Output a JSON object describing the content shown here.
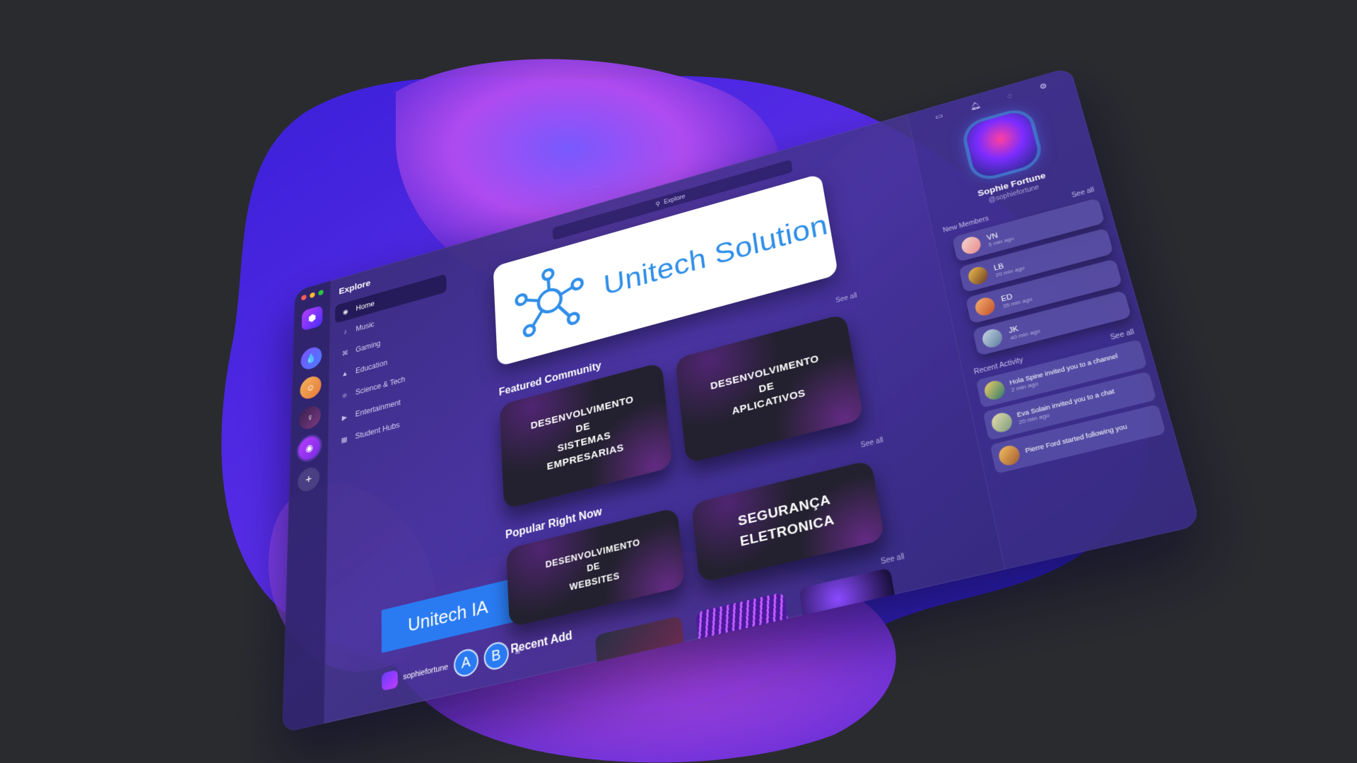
{
  "colors": {
    "background": "#2a2b2f",
    "accent_blue": "#2a7bf2",
    "hero_text": "#2f8ee8",
    "card_bg": "#23212f"
  },
  "sidebar": {
    "title": "Explore",
    "items": [
      {
        "label": "Home",
        "icon": "compass-icon",
        "active": true
      },
      {
        "label": "Music",
        "icon": "music-note-icon"
      },
      {
        "label": "Gaming",
        "icon": "gamepad-icon"
      },
      {
        "label": "Education",
        "icon": "graduation-cap-icon"
      },
      {
        "label": "Science & Tech",
        "icon": "atom-icon"
      },
      {
        "label": "Entertainment",
        "icon": "play-icon"
      },
      {
        "label": "Student Hubs",
        "icon": "building-icon"
      }
    ],
    "ia_button": "Unitech IA",
    "username": "sophiefortune",
    "btn_a": "A",
    "btn_b": "B"
  },
  "search": {
    "placeholder": "Explore"
  },
  "hero": {
    "title": "Unitech Solution"
  },
  "sections": {
    "featured": "Featured Community",
    "popular": "Popular Right Now",
    "recent": "Recent Add",
    "see_all": "See all"
  },
  "cards": {
    "c1": "DESENVOLVIMENTO\nDE\nSISTEMAS\nEMPRESARIAS",
    "c2": "DESENVOLVIMENTO\nDE\nAPLICATIVOS",
    "c3": "DESENVOLVIMENTO\nDE\nWEBSITES",
    "c4": "SEGURANÇA\nELETRONICA"
  },
  "profile": {
    "name": "Sophie Fortune",
    "handle": "@sophiefortune"
  },
  "new_members": {
    "label": "New Members",
    "see_all": "See all",
    "items": [
      {
        "name": "VN",
        "time": "5 min ago"
      },
      {
        "name": "LB",
        "time": "20 min ago"
      },
      {
        "name": "ED",
        "time": "35 min ago"
      },
      {
        "name": "JK",
        "time": "40 min ago"
      }
    ]
  },
  "recent_activity": {
    "label": "Recent Activity",
    "see_all": "See all",
    "items": [
      {
        "text": "Hola Spine invited you to a channel",
        "time": "2 min ago"
      },
      {
        "text": "Eva Solain invited you to a chat",
        "time": "20 min ago"
      },
      {
        "text": "Pierre Ford started following you",
        "time": ""
      }
    ]
  }
}
